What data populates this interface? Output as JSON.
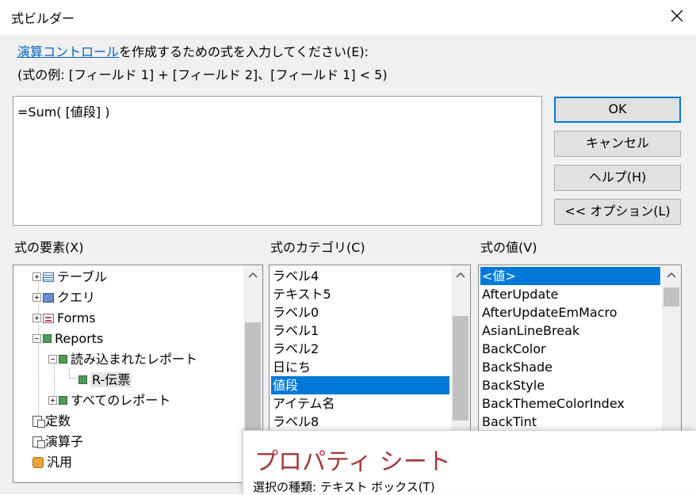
{
  "window": {
    "title": "式ビルダー",
    "close_icon": "close-icon"
  },
  "instruction": {
    "link": "演算コントロール",
    "line1_rest": "を作成するための式を入力してください(E):",
    "line2": "(式の例: [フィールド 1] + [フィールド 2]、[フィールド 1] < 5)"
  },
  "expression": {
    "value": "=Sum( [値段] )"
  },
  "buttons": {
    "ok": "OK",
    "cancel": "キャンセル",
    "help": "ヘルプ(H)",
    "options": "<< オプション(L)"
  },
  "elements": {
    "label": "式の要素(X)",
    "items": [
      {
        "label": "テーブル",
        "icon": "table-icon"
      },
      {
        "label": "クエリ",
        "icon": "query-icon"
      },
      {
        "label": "Forms",
        "icon": "forms-icon"
      },
      {
        "label": "Reports",
        "icon": "reports-icon"
      },
      {
        "label": "読み込まれたレポート",
        "icon": "report-icon"
      },
      {
        "label": "R-伝票",
        "icon": "report-icon"
      },
      {
        "label": "すべてのレポート",
        "icon": "report-icon"
      },
      {
        "label": "定数",
        "icon": "constants-icon"
      },
      {
        "label": "演算子",
        "icon": "operators-icon"
      },
      {
        "label": "汎用",
        "icon": "functions-icon"
      }
    ]
  },
  "categories": {
    "label": "式のカテゴリ(C)",
    "items": [
      "ラベル4",
      "テキスト5",
      "ラベル0",
      "ラベル1",
      "ラベル2",
      "日にち",
      "値段",
      "アイテム名",
      "ラベル8"
    ],
    "selected": "値段"
  },
  "values": {
    "label": "式の値(V)",
    "items": [
      "<値>",
      "AfterUpdate",
      "AfterUpdateEmMacro",
      "AsianLineBreak",
      "BackColor",
      "BackShade",
      "BackStyle",
      "BackThemeColorIndex",
      "BackTint"
    ],
    "selected": "<値>"
  },
  "property_sheet": {
    "title": "プロパティ シート",
    "selection_type": "選択の種類:  テキスト ボックス(T)"
  }
}
